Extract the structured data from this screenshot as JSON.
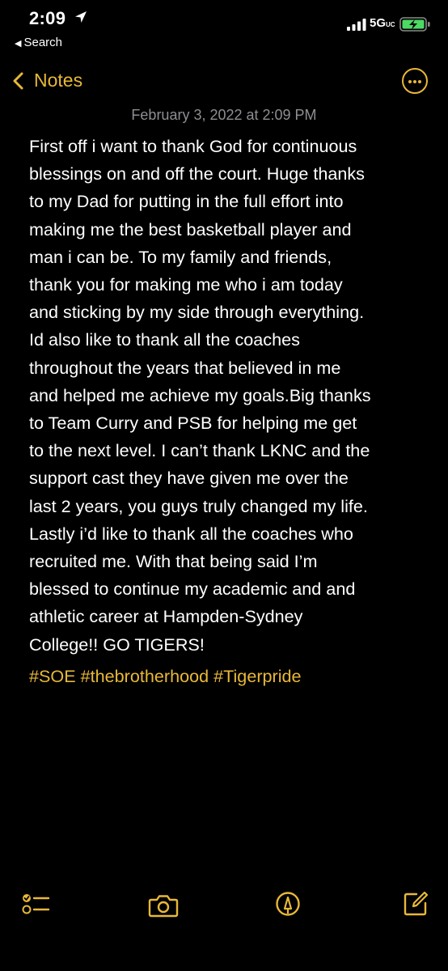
{
  "status_bar": {
    "time": "2:09",
    "back_app": "Search",
    "network": "5G",
    "network_suffix": "UC"
  },
  "nav": {
    "back_label": "Notes"
  },
  "note": {
    "date": "February 3, 2022 at 2:09 PM",
    "lines": [
      "First off i want to thank God for continuous",
      "blessings on and off the court. Huge thanks",
      "to my Dad for putting in the full effort into",
      "making me the best basketball player and",
      "man i can be. To my family and friends,",
      "thank you for making me who i am today",
      "and sticking by my side through everything.",
      "Id also like to thank all the coaches",
      "throughout the years that believed in me",
      "and helped me achieve my goals.Big thanks",
      "to Team Curry and PSB for helping me get",
      "to the next level. I can’t thank LKNC and the",
      "support cast they have given me over the",
      "last 2 years, you guys truly changed my life.",
      "Lastly i’d like to thank all the coaches who",
      "recruited me. With that being said I’m",
      "blessed to continue my academic and and",
      "athletic career at Hampden-Sydney",
      "College!! GO TIGERS!"
    ],
    "hashtags": [
      "#SOE",
      "#thebrotherhood",
      "#Tigerpride"
    ]
  },
  "toolbar": {
    "icons": [
      "checklist-icon",
      "camera-icon",
      "markup-pen-icon",
      "compose-icon"
    ]
  },
  "colors": {
    "accent": "#e8b838",
    "background": "#000000",
    "date_text": "#8e8e93",
    "battery_fill": "#4cd964"
  }
}
